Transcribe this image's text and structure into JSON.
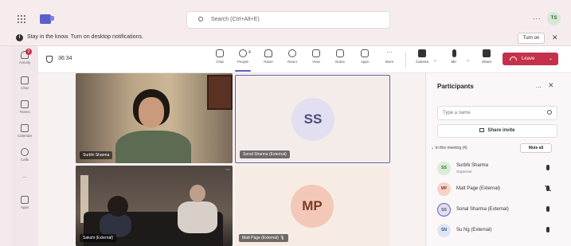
{
  "titlebar": {
    "search_placeholder": "Search (Ctrl+Alt+E)",
    "more": "...",
    "user_initials": "TS"
  },
  "notification": {
    "message": "Stay in the know. Turn on desktop notifications.",
    "turn_on_label": "Turn on",
    "close": "✕"
  },
  "rail": {
    "items": [
      {
        "label": "Activity",
        "badge": "2",
        "icon": "bell-icon"
      },
      {
        "label": "Chat",
        "icon": "chat-icon"
      },
      {
        "label": "Teams",
        "icon": "teams-icon"
      },
      {
        "label": "Calendar",
        "icon": "calendar-icon"
      },
      {
        "label": "Calls",
        "icon": "phone-icon"
      },
      {
        "label": "...",
        "icon": "more-icon"
      },
      {
        "label": "Apps",
        "icon": "apps-icon"
      }
    ]
  },
  "toolbar": {
    "timer": "36:34",
    "buttons": [
      {
        "label": "Chat",
        "icon": "chat-icon"
      },
      {
        "label": "People",
        "count": "4",
        "icon": "people-icon"
      },
      {
        "label": "Raise",
        "icon": "raise-hand-icon"
      },
      {
        "label": "React",
        "icon": "react-icon"
      },
      {
        "label": "View",
        "icon": "view-icon"
      },
      {
        "label": "Notes",
        "icon": "notes-icon"
      },
      {
        "label": "Apps",
        "icon": "apps-icon"
      },
      {
        "label": "More",
        "icon": "more-icon"
      }
    ],
    "devices": [
      {
        "label": "Camera",
        "icon": "camera-icon"
      },
      {
        "label": "Mic",
        "icon": "mic-icon"
      },
      {
        "label": "Share",
        "icon": "share-icon"
      }
    ],
    "leave_label": "Leave"
  },
  "stage": {
    "tiles": [
      {
        "name": "Surbhi Sharma"
      },
      {
        "name": "Sonal Sharma (External)",
        "initials": "SS"
      },
      {
        "name": "Sakshi (External)"
      },
      {
        "name": "Matt Page (External)",
        "initials": "MP"
      }
    ]
  },
  "participants": {
    "title": "Participants",
    "more": "...",
    "close": "✕",
    "search_placeholder": "Type a name",
    "share_invite": "Share invite",
    "in_meeting_label": "In this meeting (4)",
    "mute_all": "Mute all",
    "list": [
      {
        "initials": "SS",
        "name": "Surbhi Sharma",
        "role": "Organizer",
        "muted": false,
        "bg": "#d8ecd7",
        "fg": "#2f6b2f"
      },
      {
        "initials": "MP",
        "name": "Matt Page (External)",
        "role": "",
        "muted": true,
        "bg": "#f6d3c8",
        "fg": "#8a3a26"
      },
      {
        "initials": "SS",
        "name": "Sonal Sharma (External)",
        "role": "",
        "muted": false,
        "bg": "#e1dff0",
        "fg": "#4f4a7a"
      },
      {
        "initials": "SN",
        "name": "Su Ng (External)",
        "role": "",
        "muted": false,
        "bg": "#dce6f2",
        "fg": "#2b4f7a"
      }
    ]
  },
  "colors": {
    "accent": "#5b5fc7",
    "leave": "#c4314b"
  }
}
